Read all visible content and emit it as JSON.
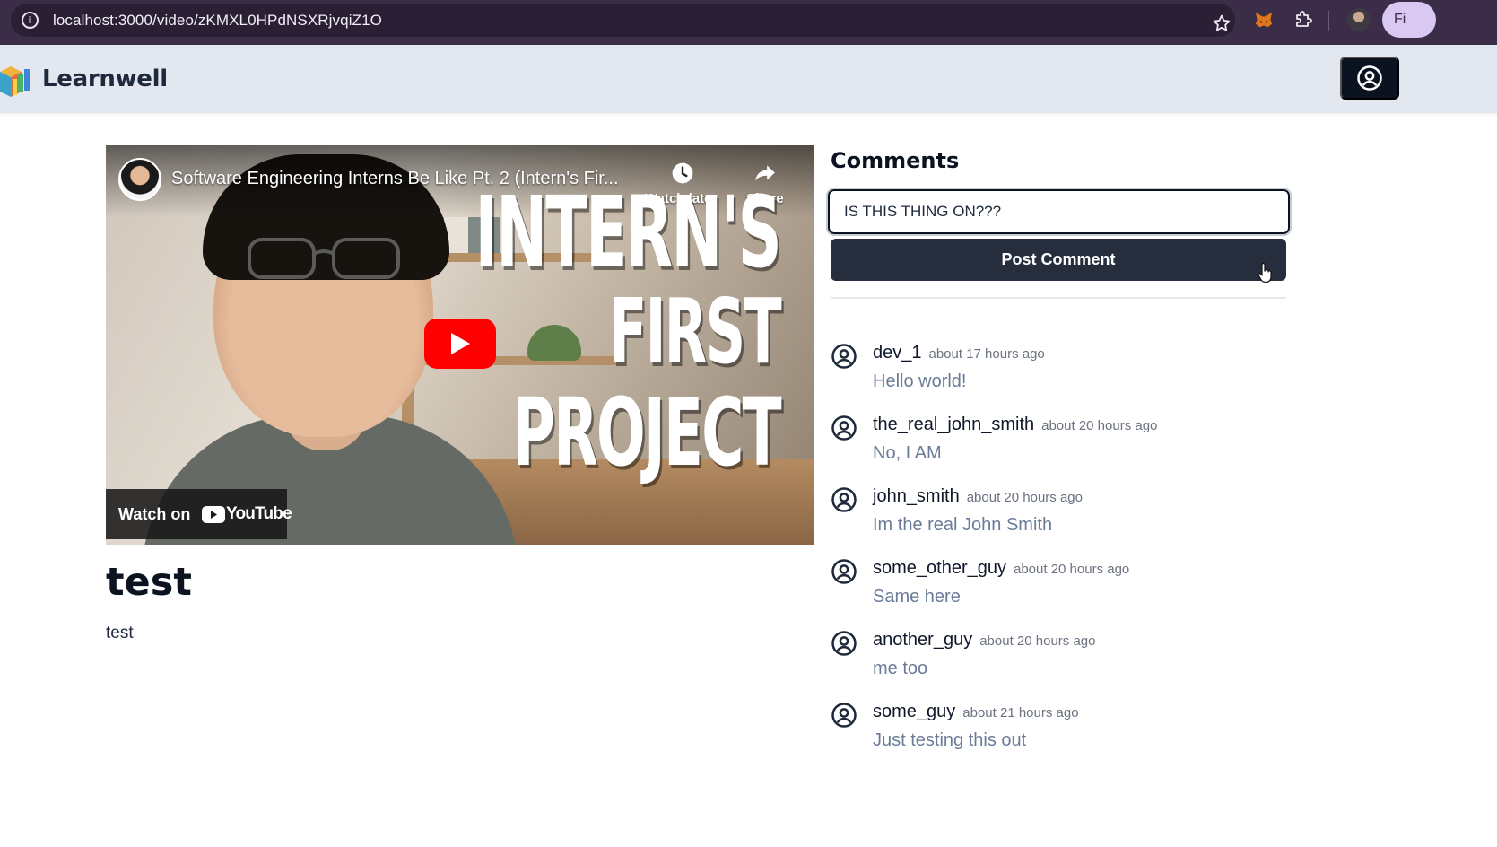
{
  "browser": {
    "url": "localhost:3000/video/zKMXL0HPdNSXRjvqiZ1O",
    "profile_chip": "Fi"
  },
  "header": {
    "brand": "Learnwell"
  },
  "video": {
    "title": "Software Engineering Interns Be Like Pt. 2 (Intern's Fir...",
    "watch_later_label": "Watch later",
    "share_label": "Share",
    "overlay_line_1": "INTERN'S",
    "overlay_line_2": "FIRST",
    "overlay_line_3": "PROJECT",
    "watch_on_label": "Watch on",
    "youtube_wordmark": "YouTube",
    "heading": "test",
    "description": "test"
  },
  "comments": {
    "heading": "Comments",
    "input_value": "IS THIS THING ON???",
    "post_label": "Post Comment",
    "items": [
      {
        "author": "dev_1",
        "time": "about 17 hours ago",
        "body": "Hello world!"
      },
      {
        "author": "the_real_john_smith",
        "time": "about 20 hours ago",
        "body": "No, I AM"
      },
      {
        "author": "john_smith",
        "time": "about 20 hours ago",
        "body": "Im the real John Smith"
      },
      {
        "author": "some_other_guy",
        "time": "about 20 hours ago",
        "body": "Same here"
      },
      {
        "author": "another_guy",
        "time": "about 20 hours ago",
        "body": "me too"
      },
      {
        "author": "some_guy",
        "time": "about 21 hours ago",
        "body": "Just testing this out"
      }
    ]
  },
  "colors": {
    "browser_chrome": "#3b2c48",
    "app_header": "#e3e8f0",
    "primary_button": "#262d3d",
    "comment_body_text": "#6b7c99",
    "youtube_red": "#ff0000"
  }
}
